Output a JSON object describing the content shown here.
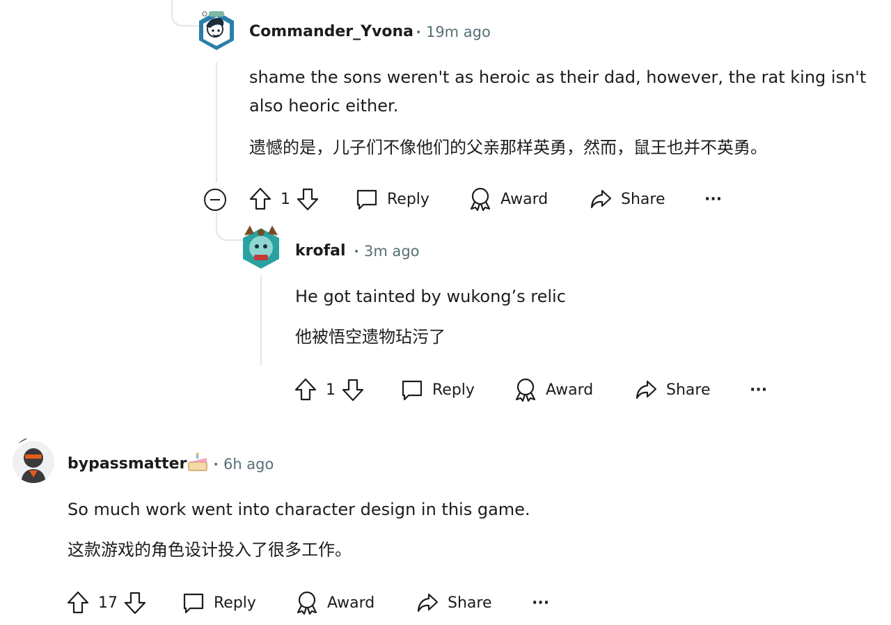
{
  "comments": [
    {
      "username": "Commander_Yvona",
      "time": "19m ago",
      "text_en_1": "shame the sons weren't as heroic as their dad, however, the rat king isn't",
      "text_en_2": "also heoric either.",
      "text_zh": "遗憾的是，儿子们不像他们的父亲那样英勇，然而，鼠王也并不英勇。",
      "votes": "1",
      "reply_label": "Reply",
      "award_label": "Award",
      "share_label": "Share",
      "more_label": "···",
      "avatar_colors": {
        "primary": "#2a7fa8",
        "secondary": "#1d2d3a"
      }
    },
    {
      "username": "krofal",
      "time": "3m ago",
      "text_en": "He got tainted by wukong’s relic",
      "text_zh": "他被悟空遗物玷污了",
      "votes": "1",
      "reply_label": "Reply",
      "award_label": "Award",
      "share_label": "Share",
      "more_label": "···",
      "avatar_colors": {
        "primary": "#2aa2a0",
        "secondary": "#7a4a22"
      }
    },
    {
      "username": "bypassmatter",
      "time": "6h ago",
      "text_en": "So much work went into character design in this game.",
      "text_zh": "这款游戏的角色设计投入了很多工作。",
      "votes": "17",
      "reply_label": "Reply",
      "award_label": "Award",
      "share_label": "Share",
      "more_label": "···",
      "avatar_colors": {
        "primary": "#3a3a3a",
        "secondary": "#e85a1a"
      }
    }
  ],
  "separator": "•",
  "colors": {
    "text": "#1c1c1c",
    "meta": "#576f76",
    "thread": "#e3e6e8"
  }
}
